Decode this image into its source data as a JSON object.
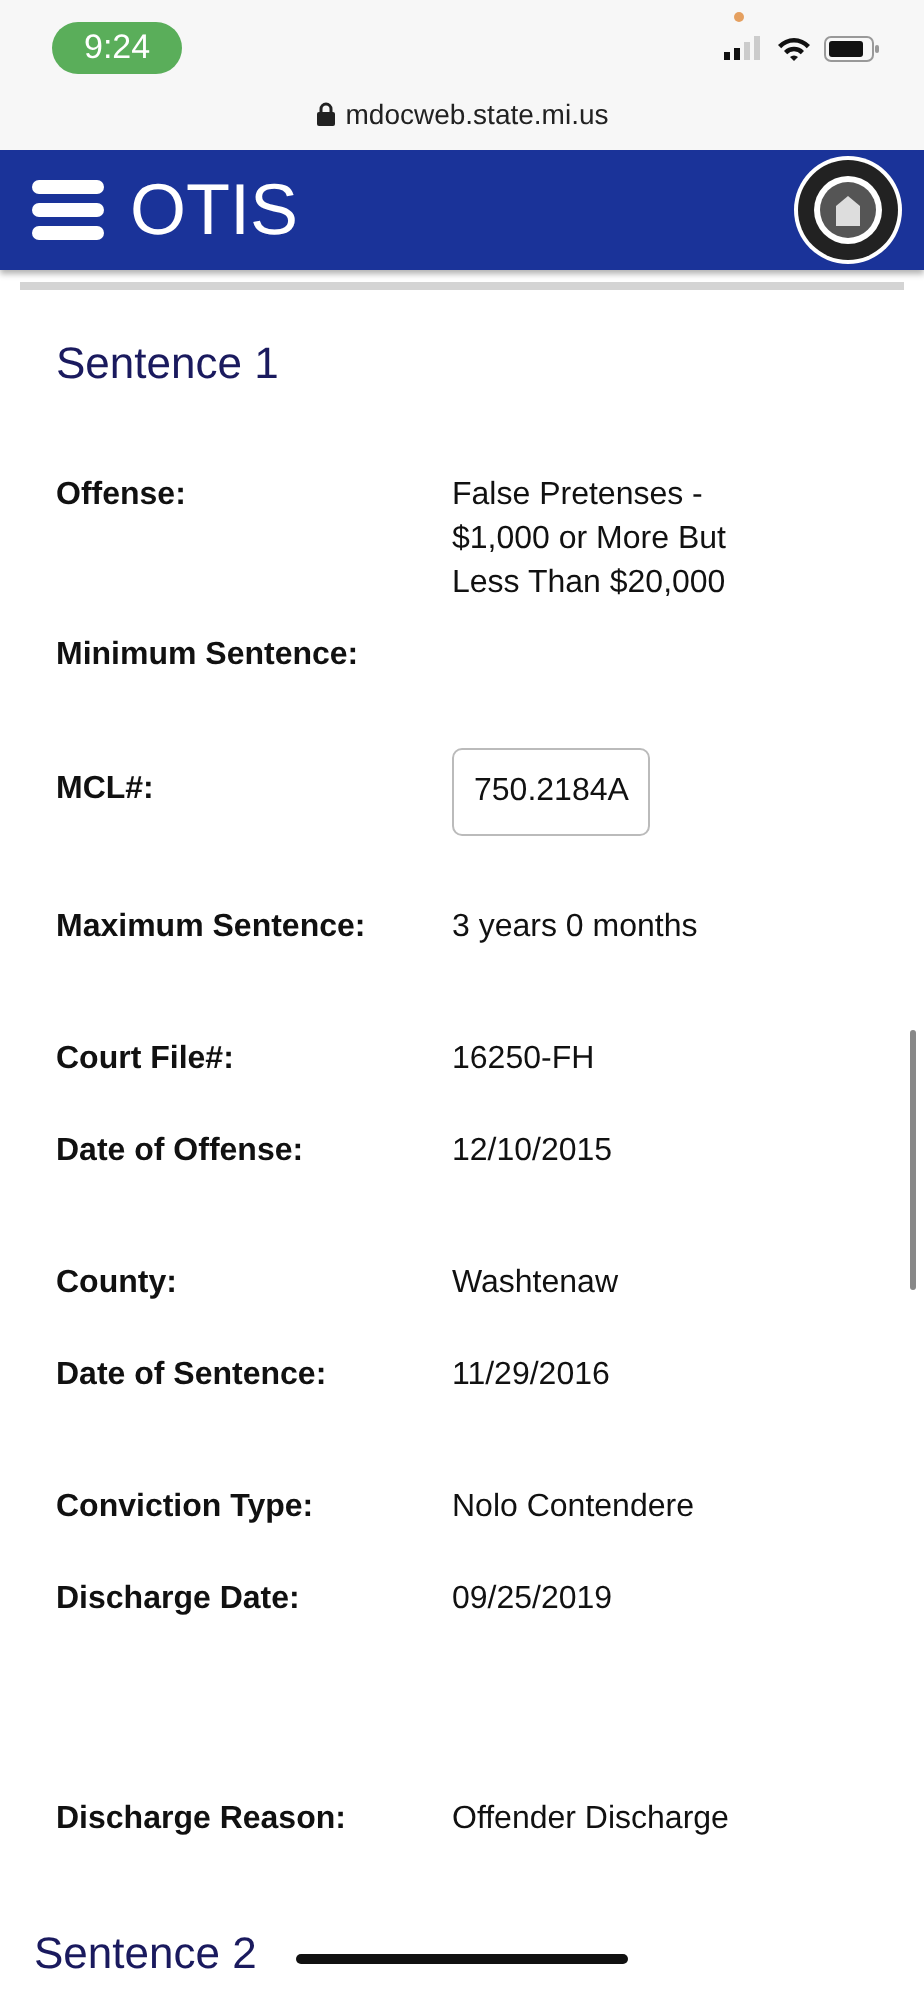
{
  "status_bar": {
    "time": "9:24"
  },
  "address_bar": {
    "url": "mdocweb.state.mi.us"
  },
  "header": {
    "title": "OTIS"
  },
  "sections": [
    {
      "heading": "Sentence 1",
      "fields": [
        {
          "label": "Offense:",
          "kind": "text",
          "value": "False Pretenses - $1,000 or More But Less Than $20,000"
        },
        {
          "label": "Minimum Sentence:"
        },
        {
          "label": "MCL#:",
          "kind": "button",
          "value": "750.2184A"
        },
        {
          "label": "Maximum Sentence:",
          "kind": "text",
          "value": "3 years 0 months"
        },
        {
          "label": "Court File#:",
          "kind": "text",
          "value": "16250-FH"
        },
        {
          "label": "Date of Offense:",
          "kind": "text",
          "value": "12/10/2015"
        },
        {
          "label": "County:",
          "kind": "text",
          "value": "Washtenaw"
        },
        {
          "label": "Date of Sentence:",
          "kind": "text",
          "value": "11/29/2016"
        },
        {
          "label": "Conviction Type:",
          "kind": "text",
          "value": "Nolo Contendere"
        },
        {
          "label": "Discharge Date:",
          "kind": "text",
          "value": "09/25/2019"
        },
        {
          "label": "Discharge Reason:",
          "kind": "text",
          "value": "Offender Discharge"
        }
      ]
    },
    {
      "heading": "Sentence 2"
    }
  ]
}
